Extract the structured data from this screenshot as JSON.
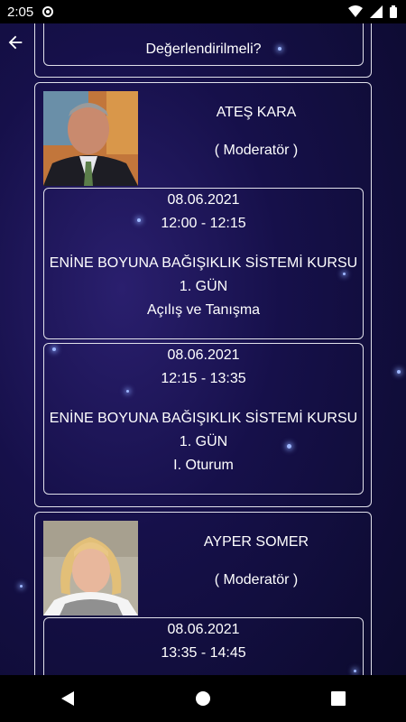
{
  "status_bar": {
    "time": "2:05"
  },
  "top_card": {
    "text": "Değerlendirilmeli?"
  },
  "speakers": [
    {
      "name": "ATEŞ KARA",
      "role": "( Moderatör )",
      "sessions": [
        {
          "date": "08.06.2021",
          "time": "12:00 - 12:15",
          "course": "ENİNE BOYUNA BAĞIŞIKLIK SİSTEMİ KURSU",
          "day": "1. GÜN",
          "title": "Açılış ve Tanışma"
        },
        {
          "date": "08.06.2021",
          "time": "12:15 - 13:35",
          "course": "ENİNE BOYUNA BAĞIŞIKLIK SİSTEMİ KURSU",
          "day": "1. GÜN",
          "title": "I. Oturum"
        }
      ]
    },
    {
      "name": "AYPER SOMER",
      "role": "( Moderatör )",
      "sessions": [
        {
          "date": "08.06.2021",
          "time": "13:35 - 14:45"
        }
      ]
    }
  ],
  "icons": {
    "back": "arrow-left-icon",
    "nav_back": "triangle-back-icon",
    "nav_home": "circle-home-icon",
    "nav_recents": "square-recents-icon"
  }
}
